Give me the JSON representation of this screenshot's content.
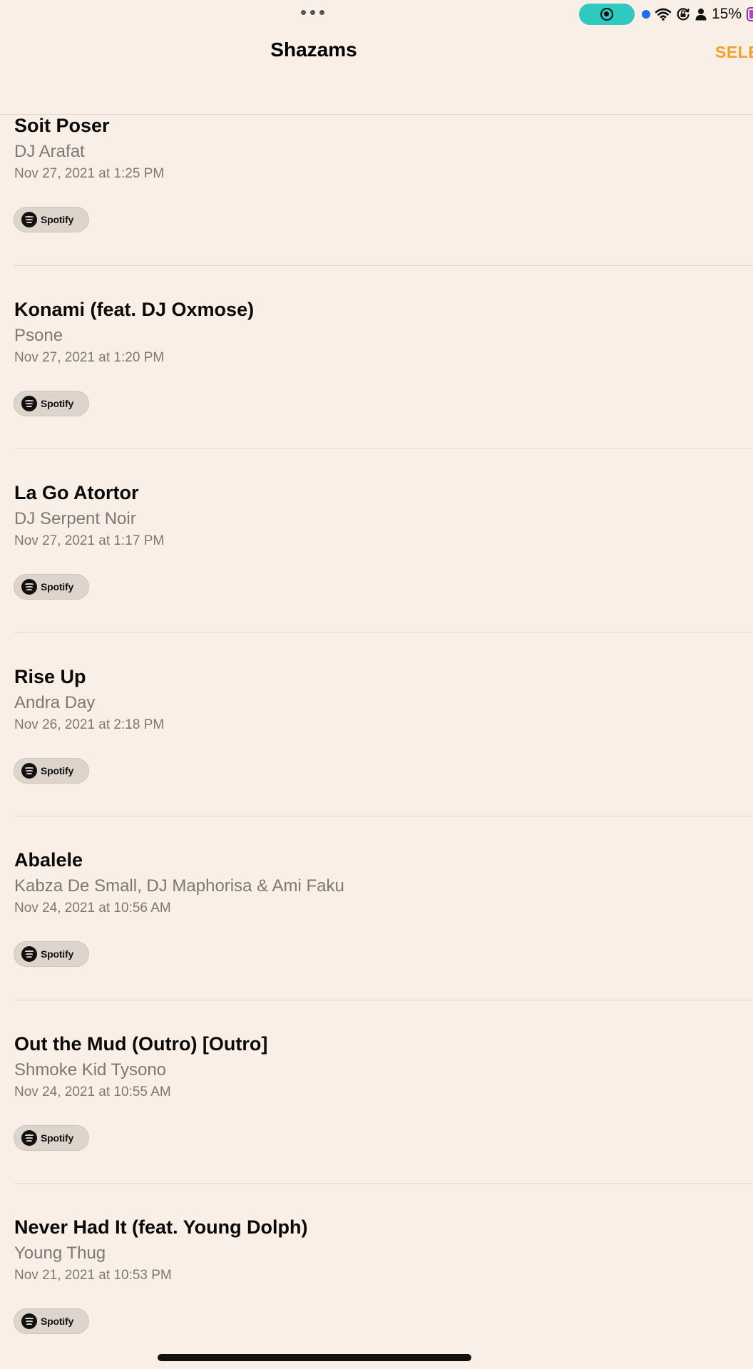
{
  "status_bar": {
    "battery_percent": "15%",
    "icons": [
      "multitask-dots-icon",
      "screen-recording-icon",
      "location-dot-icon",
      "wifi-icon",
      "orientation-lock-icon",
      "person-icon",
      "battery-icon"
    ],
    "recording_color": "#30c9c0"
  },
  "nav": {
    "title": "Shazams",
    "select_label": "SELE",
    "accent_color": "#f0a02b"
  },
  "songs": [
    {
      "title": "Soit Poser",
      "artist": "DJ Arafat",
      "date": "Nov 27, 2021 at 1:25 PM",
      "service": "Spotify"
    },
    {
      "title": "Konami (feat. DJ Oxmose)",
      "artist": "Psone",
      "date": "Nov 27, 2021 at 1:20 PM",
      "service": "Spotify"
    },
    {
      "title": "La Go Atortor",
      "artist": "DJ Serpent Noir",
      "date": "Nov 27, 2021 at 1:17 PM",
      "service": "Spotify"
    },
    {
      "title": "Rise Up",
      "artist": "Andra Day",
      "date": "Nov 26, 2021 at 2:18 PM",
      "service": "Spotify"
    },
    {
      "title": "Abalele",
      "artist": "Kabza De Small, DJ Maphorisa & Ami Faku",
      "date": "Nov 24, 2021 at 10:56 AM",
      "service": "Spotify"
    },
    {
      "title": "Out the Mud (Outro) [Outro]",
      "artist": "Shmoke Kid Tysono",
      "date": "Nov 24, 2021 at 10:55 AM",
      "service": "Spotify"
    },
    {
      "title": "Never Had It (feat. Young Dolph)",
      "artist": "Young Thug",
      "date": "Nov 21, 2021 at 10:53 PM",
      "service": "Spotify"
    }
  ]
}
